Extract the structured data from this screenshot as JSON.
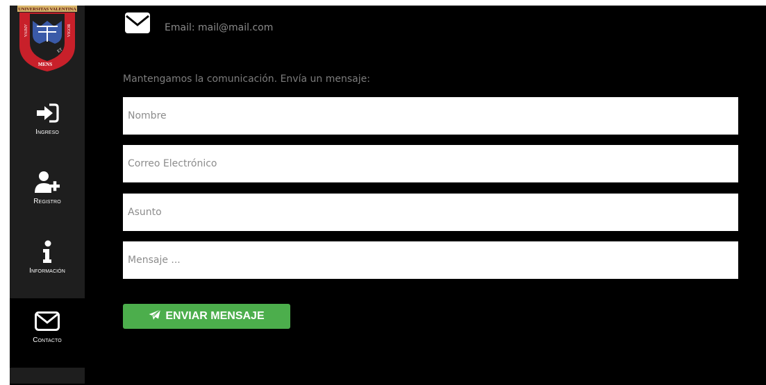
{
  "sidebar": {
    "logo": {
      "banner": "UNIVERSITAS VALENTINA",
      "left_ribbon": "ANIVA",
      "right_ribbon": "VIGOR",
      "et": "ET",
      "mens": "MENS"
    },
    "items": [
      {
        "label": "Ingreso",
        "icon": "sign-in-icon",
        "active": false
      },
      {
        "label": "Registro",
        "icon": "user-plus-icon",
        "active": false
      },
      {
        "label": "Información",
        "icon": "info-icon",
        "active": false
      },
      {
        "label": "Contacto",
        "icon": "envelope-icon",
        "active": true
      }
    ]
  },
  "contact": {
    "email_label": "Email: mail@mail.com",
    "intro_text": "Mantengamos la comunicación. Envía un mensaje:",
    "fields": {
      "name_placeholder": "Nombre",
      "email_placeholder": "Correo Electrónico",
      "subject_placeholder": "Asunto",
      "message_placeholder": "Mensaje ..."
    },
    "submit_label": "ENVIAR MENSAJE",
    "submit_icon": "paper-plane-icon"
  },
  "colors": {
    "background": "#000000",
    "sidebar": "#1e1e1e",
    "button": "#4cae4c",
    "muted_text": "#8a8a8a",
    "logo_red": "#c8202a",
    "logo_blue": "#3a5aa8"
  }
}
